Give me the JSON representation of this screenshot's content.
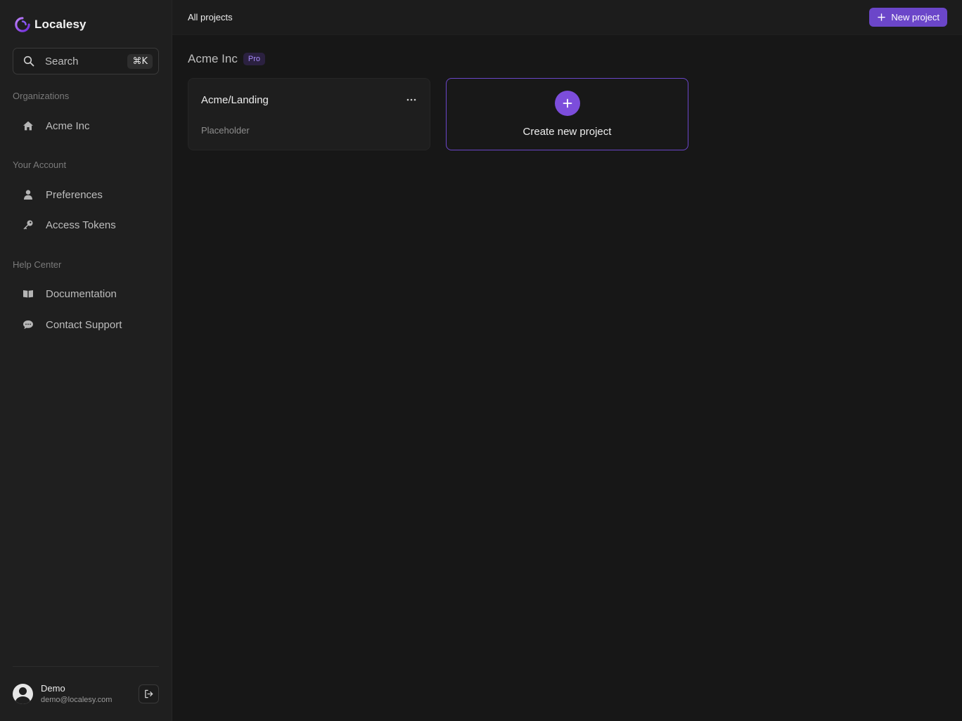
{
  "app": {
    "name": "Localesy"
  },
  "search": {
    "placeholder": "Search",
    "shortcut": "⌘K"
  },
  "sidebar": {
    "sections": [
      {
        "title": "Organizations",
        "items": [
          {
            "label": "Acme Inc",
            "icon": "home-icon"
          }
        ]
      },
      {
        "title": "Your Account",
        "items": [
          {
            "label": "Preferences",
            "icon": "user-icon"
          },
          {
            "label": "Access Tokens",
            "icon": "key-icon"
          }
        ]
      },
      {
        "title": "Help Center",
        "items": [
          {
            "label": "Documentation",
            "icon": "book-icon"
          },
          {
            "label": "Contact Support",
            "icon": "chat-icon"
          }
        ]
      }
    ]
  },
  "user": {
    "name": "Demo",
    "email": "demo@localesy.com"
  },
  "header": {
    "breadcrumb": "All projects",
    "new_button": "New project"
  },
  "org": {
    "name": "Acme Inc",
    "plan": "Pro"
  },
  "projects": [
    {
      "name": "Acme/Landing",
      "description": "Placeholder"
    }
  ],
  "create_card": {
    "label": "Create new project"
  },
  "colors": {
    "accent": "#6b46c9",
    "background": "#171717",
    "sidebar": "#1f1f1f"
  }
}
